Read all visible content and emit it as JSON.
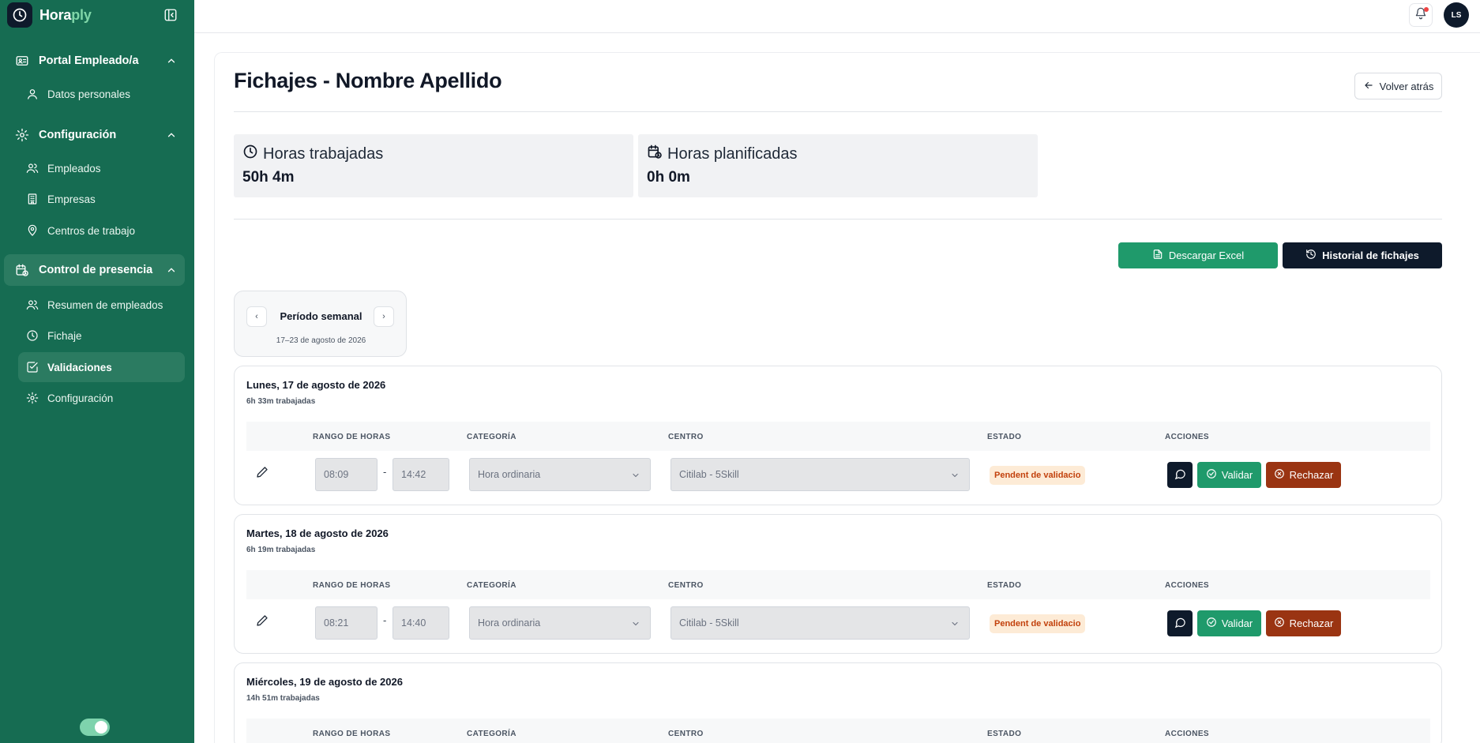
{
  "app": {
    "brand_part1": "Hora",
    "brand_part2": "ply"
  },
  "sidebar": {
    "sections": [
      {
        "label": "Portal Empleado/a",
        "icon": "id-card-icon",
        "items": [
          {
            "label": "Datos personales",
            "icon": "user-icon"
          }
        ]
      },
      {
        "label": "Configuración",
        "icon": "gear-icon",
        "items": [
          {
            "label": "Empleados",
            "icon": "users-icon"
          },
          {
            "label": "Empresas",
            "icon": "building-icon"
          },
          {
            "label": "Centros de trabajo",
            "icon": "map-pin-icon"
          }
        ]
      },
      {
        "label": "Control de presencia",
        "icon": "calendar-clock-icon",
        "active": true,
        "items": [
          {
            "label": "Resumen de empleados",
            "icon": "users-icon"
          },
          {
            "label": "Fichaje",
            "icon": "clock-icon"
          },
          {
            "label": "Validaciones",
            "icon": "check-square-icon",
            "active": true
          },
          {
            "label": "Configuración",
            "icon": "gear-icon"
          }
        ]
      }
    ]
  },
  "topbar": {
    "avatar_initials": "LS"
  },
  "page": {
    "title": "Fichajes - Nombre Apellido",
    "back_label": "Volver atrás"
  },
  "stats": {
    "worked": {
      "label": "Horas trabajadas",
      "value": "50h 4m"
    },
    "planned": {
      "label": "Horas planificadas",
      "value": "0h 0m"
    }
  },
  "toolbar": {
    "excel_label": "Descargar Excel",
    "history_label": "Historial de fichajes"
  },
  "period": {
    "label": "Período semanal",
    "range": "17–23 de agosto de 2026",
    "prev": "‹",
    "next": "›"
  },
  "table_headers": {
    "range": "RANGO DE HORAS",
    "category": "CATEGORÍA",
    "center": "CENTRO",
    "status": "ESTADO",
    "actions": "ACCIONES"
  },
  "actions": {
    "validate": "Validar",
    "reject": "Rechazar"
  },
  "days": [
    {
      "title": "Lunes, 17 de agosto de 2026",
      "worked": "6h 33m trabajadas",
      "start": "08:09",
      "end": "14:42",
      "category": "Hora ordinaria",
      "center": "Citilab - 5Skill",
      "status": "Pendent de validacio"
    },
    {
      "title": "Martes, 18 de agosto de 2026",
      "worked": "6h 19m trabajadas",
      "start": "08:21",
      "end": "14:40",
      "category": "Hora ordinaria",
      "center": "Citilab - 5Skill",
      "status": "Pendent de validacio"
    },
    {
      "title": "Miércoles, 19 de agosto de 2026",
      "worked": "14h 51m trabajadas"
    }
  ],
  "colors": {
    "sidebar": "#166c52",
    "primary_dark": "#0e1a2b",
    "success": "#1f9a6b",
    "danger": "#9a3412",
    "pending_bg": "#fdebd6",
    "pending_text": "#c2410c"
  }
}
